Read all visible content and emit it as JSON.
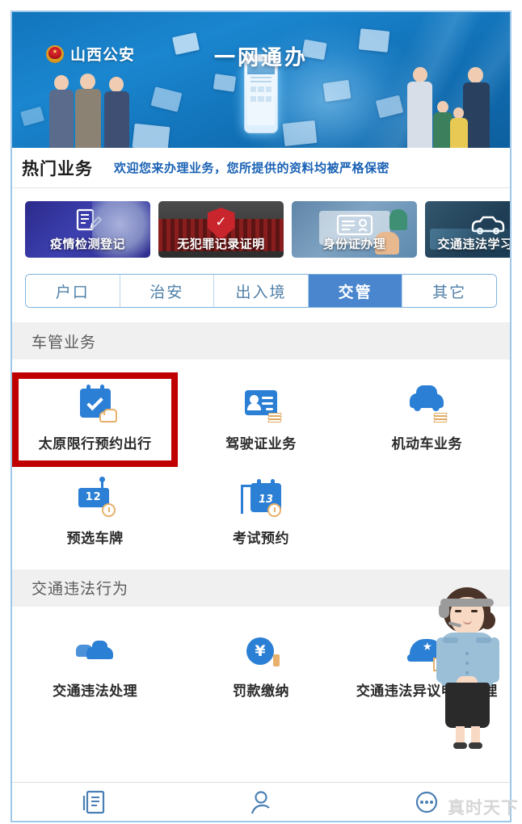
{
  "banner": {
    "brand": "山西公安",
    "title": "一网通办",
    "badge_icon": "police-badge-icon"
  },
  "hot_services": {
    "title": "热门业务",
    "subtitle": "欢迎您来办理业务，您所提供的资料均被严格保密",
    "cards": [
      {
        "label": "疫情检测登记",
        "icon": "document-edit-icon"
      },
      {
        "label": "无犯罪记录证明",
        "icon": "shield-check-icon"
      },
      {
        "label": "身份证办理",
        "icon": "id-card-icon"
      },
      {
        "label": "交通违法学习教育",
        "icon": "car-outline-icon"
      }
    ]
  },
  "tabs": [
    {
      "label": "户口",
      "active": false
    },
    {
      "label": "治安",
      "active": false
    },
    {
      "label": "出入境",
      "active": false
    },
    {
      "label": "交管",
      "active": true
    },
    {
      "label": "其它",
      "active": false
    }
  ],
  "sections": [
    {
      "title": "车管业务",
      "items": [
        {
          "label": "太原限行预约出行",
          "icon": "calendar-check-car-icon",
          "highlighted": true
        },
        {
          "label": "驾驶证业务",
          "icon": "driver-license-icon",
          "highlighted": false
        },
        {
          "label": "机动车业务",
          "icon": "car-icon",
          "highlighted": false
        },
        {
          "label": "预选车牌",
          "icon": "license-plate-icon",
          "highlighted": false
        },
        {
          "label": "考试预约",
          "icon": "exam-calendar-icon",
          "highlighted": false
        }
      ]
    },
    {
      "title": "交通违法行为",
      "items": [
        {
          "label": "交通违法处理",
          "icon": "two-cars-icon",
          "highlighted": false
        },
        {
          "label": "罚款缴纳",
          "icon": "yuan-payment-icon",
          "highlighted": false
        },
        {
          "label": "交通违法异议申诉受理",
          "icon": "police-cap-doc-icon",
          "highlighted": false
        }
      ]
    }
  ],
  "icon_text": {
    "plate_number": "12",
    "exam_day": "13",
    "yuan_symbol": "¥"
  },
  "mascot": {
    "name": "police-officer-mascot"
  },
  "bottom_nav": [
    {
      "icon": "document-print-icon"
    },
    {
      "icon": "person-icon"
    },
    {
      "icon": "more-dots-icon"
    }
  ],
  "watermark": "真时天下",
  "colors": {
    "highlight_red": "#C00000",
    "accent_blue": "#2b7fd4",
    "tab_active_blue": "#4a86cd",
    "section_header_gray": "#f0f0f0"
  }
}
